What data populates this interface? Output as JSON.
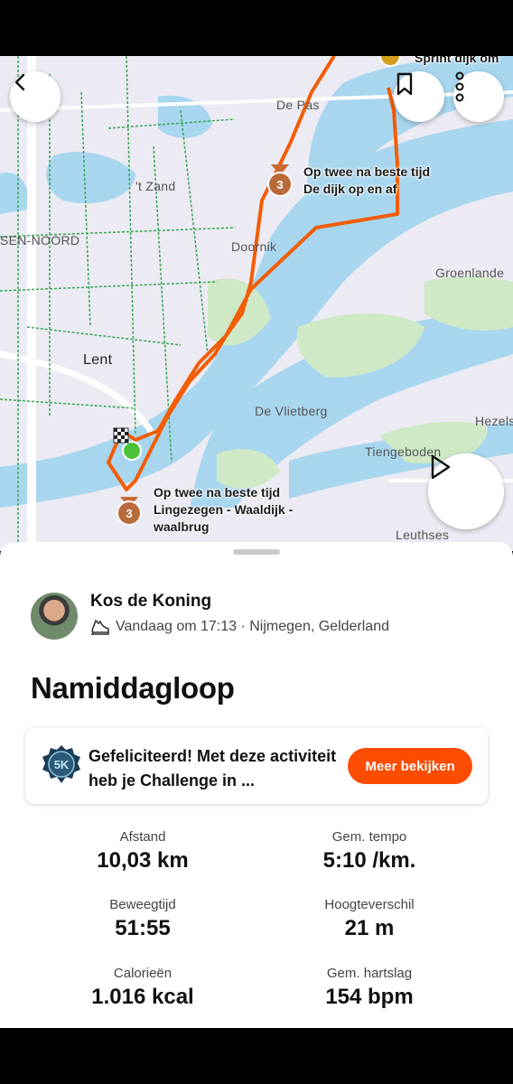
{
  "map": {
    "place_labels": [
      "De Pas",
      "'t Zand",
      "SEN-NOORD",
      "Doornik",
      "Lent",
      "De Vlietberg",
      "Groenlande",
      "Tiengeboden",
      "Hezels",
      "Leuthses"
    ],
    "segments": [
      {
        "line1": "Sprint dijk om",
        "line2": ""
      },
      {
        "line1": "Op twee na beste tijd",
        "line2": "De dijk op en af"
      },
      {
        "line1": "Op twee na beste tijd",
        "line2": "Lingezegen - Waaldijk -",
        "line3": "waalbrug"
      }
    ],
    "medal_rank": "3",
    "route_color": "#f25c05",
    "water_color": "#a8d6ef",
    "green_color": "#cfe8c6"
  },
  "athlete": {
    "name": "Kos de Koning",
    "meta": "Vandaag om 17:13 · Nijmegen, Gelderland"
  },
  "activity": {
    "title": "Namiddagloop"
  },
  "challenge": {
    "badge_text": "5K",
    "message": "Gefeliciteerd! Met deze activiteit heb je Challenge in ...",
    "button_label": "Meer bekijken"
  },
  "stats": [
    {
      "label": "Afstand",
      "value": "10,03 km"
    },
    {
      "label": "Gem. tempo",
      "value": "5:10 /km."
    },
    {
      "label": "Beweegtijd",
      "value": "51:55"
    },
    {
      "label": "Hoogteverschil",
      "value": "21 m"
    },
    {
      "label": "Calorieën",
      "value": "1.016 kcal"
    },
    {
      "label": "Gem. hartslag",
      "value": "154 bpm"
    }
  ],
  "icons": [
    "back-icon",
    "bookmark-icon",
    "more-icon",
    "play-icon",
    "shoe-icon",
    "medal-icon",
    "start-flag-icon"
  ]
}
